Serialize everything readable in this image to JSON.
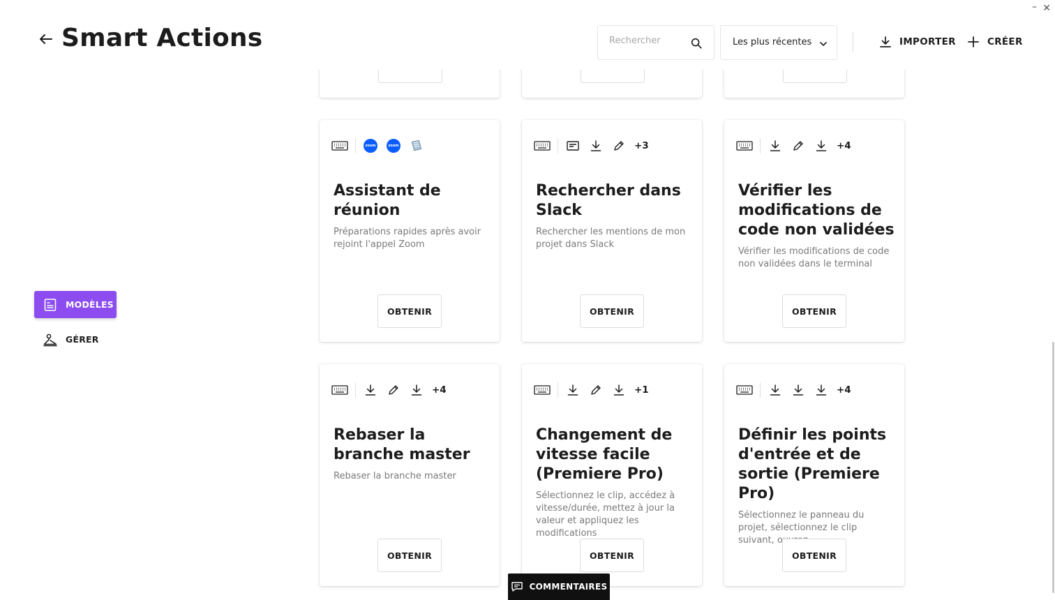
{
  "window": {
    "minimize": "–",
    "close": "✕"
  },
  "header": {
    "title": "Smart Actions",
    "search_placeholder": "Rechercher",
    "sort_value": "Les plus récentes",
    "import_label": "IMPORTER",
    "create_label": "CRÉER"
  },
  "sidebar": {
    "items": [
      {
        "label": "MODÈLES",
        "active": true
      },
      {
        "label": "GÉRER",
        "active": false
      }
    ]
  },
  "colors": {
    "accent": "#8c4cf0",
    "zoom": "#0b5cff",
    "feedback_bg": "#101010"
  },
  "cards": [
    {
      "icons": [
        "keyboard-icon",
        "zoom-icon",
        "zoom-icon",
        "notebook-icon"
      ],
      "more": "",
      "title": "Assistant de réunion",
      "description": "Préparations rapides après avoir rejoint l'appel Zoom",
      "button": "OBTENIR"
    },
    {
      "icons": [
        "keyboard-icon",
        "text-block-icon",
        "download-icon",
        "pencil-icon"
      ],
      "more": "+3",
      "title": "Rechercher dans Slack",
      "description": "Rechercher les mentions de mon projet dans Slack",
      "button": "OBTENIR"
    },
    {
      "icons": [
        "keyboard-icon",
        "download-icon",
        "pencil-icon",
        "download-icon"
      ],
      "more": "+4",
      "title": "Vérifier les modifications de code non validées",
      "description": "Vérifier les modifications de code non validées dans le terminal",
      "button": "OBTENIR"
    },
    {
      "icons": [
        "keyboard-icon",
        "download-icon",
        "pencil-icon",
        "download-icon"
      ],
      "more": "+4",
      "title": "Rebaser la branche master",
      "description": "Rebaser la branche master",
      "button": "OBTENIR"
    },
    {
      "icons": [
        "keyboard-icon",
        "download-icon",
        "pencil-icon",
        "download-icon"
      ],
      "more": "+1",
      "title": "Changement de vitesse facile (Premiere Pro)",
      "description": "Sélectionnez le clip, accédez à vitesse/durée, mettez à jour la valeur et appliquez les modifications",
      "button": "OBTENIR"
    },
    {
      "icons": [
        "keyboard-icon",
        "download-icon",
        "download-icon",
        "download-icon"
      ],
      "more": "+4",
      "title": "Définir les points d'entrée et de sortie (Premiere Pro)",
      "description": "Sélectionnez le panneau du projet, sélectionnez le clip suivant, ouvrez",
      "button": "OBTENIR"
    }
  ],
  "feedback_label": "COMMENTAIRES"
}
